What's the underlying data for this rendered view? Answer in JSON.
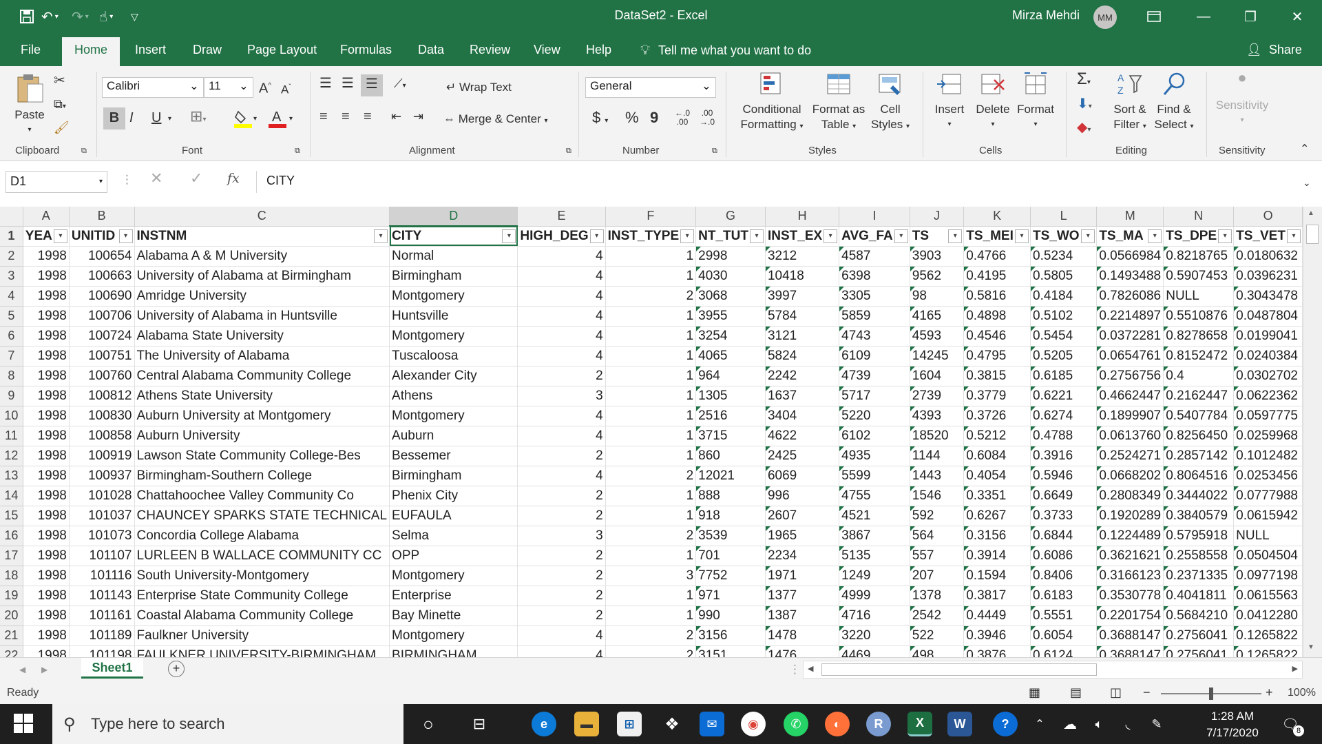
{
  "window": {
    "title": "DataSet2  -  Excel",
    "user": "Mirza Mehdi",
    "initials": "MM"
  },
  "tabs": [
    "File",
    "Home",
    "Insert",
    "Draw",
    "Page Layout",
    "Formulas",
    "Data",
    "Review",
    "View",
    "Help"
  ],
  "tell_me": "Tell me what you want to do",
  "share": "Share",
  "ribbon": {
    "clipboard": {
      "label": "Clipboard",
      "paste": "Paste"
    },
    "font": {
      "label": "Font",
      "name": "Calibri",
      "size": "11",
      "bold": "B",
      "italic": "I",
      "underline": "U"
    },
    "alignment": {
      "label": "Alignment",
      "wrap": "Wrap Text",
      "merge": "Merge & Center"
    },
    "number": {
      "label": "Number",
      "format": "General",
      "currency": "$",
      "percent": "%",
      "comma": "9"
    },
    "styles": {
      "label": "Styles",
      "conditional": [
        "Conditional",
        "Formatting"
      ],
      "format_table": [
        "Format as",
        "Table"
      ],
      "cell_styles": [
        "Cell",
        "Styles"
      ]
    },
    "cells": {
      "label": "Cells",
      "insert": "Insert",
      "delete": "Delete",
      "format": "Format"
    },
    "editing": {
      "label": "Editing",
      "sort": [
        "Sort &",
        "Filter"
      ],
      "find": [
        "Find &",
        "Select"
      ]
    },
    "sensitivity": {
      "label": "Sensitivity",
      "button": "Sensitivity"
    }
  },
  "formula_bar": {
    "name_box": "D1",
    "content": "CITY"
  },
  "columns": [
    "A",
    "B",
    "C",
    "D",
    "E",
    "F",
    "G",
    "H",
    "I",
    "J",
    "K",
    "L",
    "M",
    "N",
    "O"
  ],
  "selected_column": "D",
  "headers": [
    "YEA",
    "UNITID",
    "INSTNM",
    "CITY",
    "HIGH_DEG",
    "INST_TYPE",
    "NT_TUT",
    "INST_EX",
    "AVG_FA",
    "TS",
    "TS_MEI",
    "TS_WO",
    "TS_MA",
    "TS_DPE",
    "TS_VET"
  ],
  "rows": [
    [
      "2",
      "1998",
      "100654",
      "Alabama A & M University",
      "Normal",
      "4",
      "1",
      "2998",
      "3212",
      "4587",
      "3903",
      "0.4766",
      "0.5234",
      "0.0566984",
      "0.8218765",
      "0.0180632"
    ],
    [
      "3",
      "1998",
      "100663",
      "University of Alabama at Birmingham",
      "Birmingham",
      "4",
      "1",
      "4030",
      "10418",
      "6398",
      "9562",
      "0.4195",
      "0.5805",
      "0.1493488",
      "0.5907453",
      "0.0396231"
    ],
    [
      "4",
      "1998",
      "100690",
      "Amridge University",
      "Montgomery",
      "4",
      "2",
      "3068",
      "3997",
      "3305",
      "98",
      "0.5816",
      "0.4184",
      "0.7826086",
      "NULL",
      "0.3043478"
    ],
    [
      "5",
      "1998",
      "100706",
      "University of Alabama in Huntsville",
      "Huntsville",
      "4",
      "1",
      "3955",
      "5784",
      "5859",
      "4165",
      "0.4898",
      "0.5102",
      "0.2214897",
      "0.5510876",
      "0.0487804"
    ],
    [
      "6",
      "1998",
      "100724",
      "Alabama State University",
      "Montgomery",
      "4",
      "1",
      "3254",
      "3121",
      "4743",
      "4593",
      "0.4546",
      "0.5454",
      "0.0372281",
      "0.8278658",
      "0.0199041"
    ],
    [
      "7",
      "1998",
      "100751",
      "The University of Alabama",
      "Tuscaloosa",
      "4",
      "1",
      "4065",
      "5824",
      "6109",
      "14245",
      "0.4795",
      "0.5205",
      "0.0654761",
      "0.8152472",
      "0.0240384"
    ],
    [
      "8",
      "1998",
      "100760",
      "Central Alabama Community College",
      "Alexander City",
      "2",
      "1",
      "964",
      "2242",
      "4739",
      "1604",
      "0.3815",
      "0.6185",
      "0.2756756",
      "0.4",
      "0.0302702"
    ],
    [
      "9",
      "1998",
      "100812",
      "Athens State University",
      "Athens",
      "3",
      "1",
      "1305",
      "1637",
      "5717",
      "2739",
      "0.3779",
      "0.6221",
      "0.4662447",
      "0.2162447",
      "0.0622362"
    ],
    [
      "10",
      "1998",
      "100830",
      "Auburn University at Montgomery",
      "Montgomery",
      "4",
      "1",
      "2516",
      "3404",
      "5220",
      "4393",
      "0.3726",
      "0.6274",
      "0.1899907",
      "0.5407784",
      "0.0597775"
    ],
    [
      "11",
      "1998",
      "100858",
      "Auburn University",
      "Auburn",
      "4",
      "1",
      "3715",
      "4622",
      "6102",
      "18520",
      "0.5212",
      "0.4788",
      "0.0613760",
      "0.8256450",
      "0.0259968"
    ],
    [
      "12",
      "1998",
      "100919",
      "Lawson State Community College-Bes",
      "Bessemer",
      "2",
      "1",
      "860",
      "2425",
      "4935",
      "1144",
      "0.6084",
      "0.3916",
      "0.2524271",
      "0.2857142",
      "0.1012482"
    ],
    [
      "13",
      "1998",
      "100937",
      "Birmingham-Southern College",
      "Birmingham",
      "4",
      "2",
      "12021",
      "6069",
      "5599",
      "1443",
      "0.4054",
      "0.5946",
      "0.0668202",
      "0.8064516",
      "0.0253456"
    ],
    [
      "14",
      "1998",
      "101028",
      "Chattahoochee Valley Community Co",
      "Phenix City",
      "2",
      "1",
      "888",
      "996",
      "4755",
      "1546",
      "0.3351",
      "0.6649",
      "0.2808349",
      "0.3444022",
      "0.0777988"
    ],
    [
      "15",
      "1998",
      "101037",
      "CHAUNCEY SPARKS STATE TECHNICAL",
      "EUFAULA",
      "2",
      "1",
      "918",
      "2607",
      "4521",
      "592",
      "0.6267",
      "0.3733",
      "0.1920289",
      "0.3840579",
      "0.0615942"
    ],
    [
      "16",
      "1998",
      "101073",
      "Concordia College Alabama",
      "Selma",
      "3",
      "2",
      "3539",
      "1965",
      "3867",
      "564",
      "0.3156",
      "0.6844",
      "0.1224489",
      "0.5795918",
      "NULL"
    ],
    [
      "17",
      "1998",
      "101107",
      "LURLEEN B WALLACE COMMUNITY CC",
      "OPP",
      "2",
      "1",
      "701",
      "2234",
      "5135",
      "557",
      "0.3914",
      "0.6086",
      "0.3621621",
      "0.2558558",
      "0.0504504"
    ],
    [
      "18",
      "1998",
      "101116",
      "South University-Montgomery",
      "Montgomery",
      "2",
      "3",
      "7752",
      "1971",
      "1249",
      "207",
      "0.1594",
      "0.8406",
      "0.3166123",
      "0.2371335",
      "0.0977198"
    ],
    [
      "19",
      "1998",
      "101143",
      "Enterprise State Community College",
      "Enterprise",
      "2",
      "1",
      "971",
      "1377",
      "4999",
      "1378",
      "0.3817",
      "0.6183",
      "0.3530778",
      "0.4041811",
      "0.0615563"
    ],
    [
      "20",
      "1998",
      "101161",
      "Coastal Alabama Community College",
      "Bay Minette",
      "2",
      "1",
      "990",
      "1387",
      "4716",
      "2542",
      "0.4449",
      "0.5551",
      "0.2201754",
      "0.5684210",
      "0.0412280"
    ],
    [
      "21",
      "1998",
      "101189",
      "Faulkner University",
      "Montgomery",
      "4",
      "2",
      "3156",
      "1478",
      "3220",
      "522",
      "0.3946",
      "0.6054",
      "0.3688147",
      "0.2756041",
      "0.1265822"
    ],
    [
      "22",
      "1998",
      "101198",
      "FAULKNER UNIVERSITY-BIRMINGHAM",
      "BIRMINGHAM",
      "4",
      "2",
      "3151",
      "1476",
      "4469",
      "498",
      "0.3876",
      "0.6124",
      "0.3688147",
      "0.2756041",
      "0.1265822"
    ]
  ],
  "sheet": {
    "tab": "Sheet1"
  },
  "status": {
    "ready": "Ready",
    "zoom": "100%"
  },
  "taskbar": {
    "search": "Type here to search",
    "time": "1:28 AM",
    "date": "7/17/2020",
    "notifications": "8"
  }
}
